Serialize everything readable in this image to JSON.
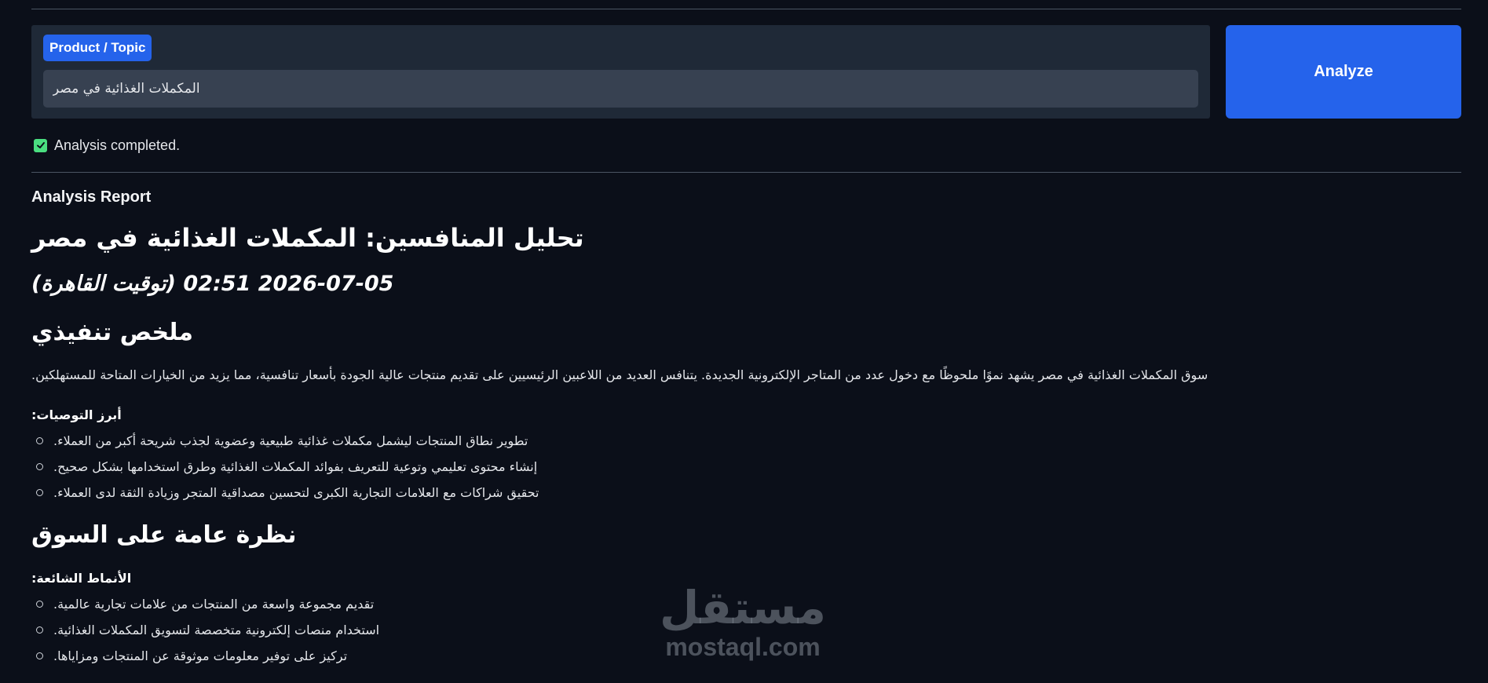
{
  "input": {
    "badge_label": "Product / Topic",
    "value": "المكملات الغذائية في مصر",
    "analyze_label": "Analyze"
  },
  "status": {
    "text": "Analysis completed.",
    "icon": "check-icon",
    "icon_color": "#4ade80"
  },
  "report": {
    "heading": "Analysis Report",
    "title": "تحليل المنافسين: المكملات الغذائية في مصر",
    "timestamp": "2026-07-05 02:51 (توقيت القاهرة)",
    "summary_heading": "ملخص تنفيذي",
    "summary_text": "سوق المكملات الغذائية في مصر يشهد نموًا ملحوظًا مع دخول عدد من المتاجر الإلكترونية الجديدة. يتنافس العديد من اللاعبين الرئيسيين على تقديم منتجات عالية الجودة بأسعار تنافسية، مما يزيد من الخيارات المتاحة للمستهلكين.",
    "recommendations_label": "أبرز التوصيات:",
    "recommendations": [
      "تطوير نطاق المنتجات ليشمل مكملات غذائية طبيعية وعضوية لجذب شريحة أكبر من العملاء.",
      "إنشاء محتوى تعليمي وتوعية للتعريف بفوائد المكملات الغذائية وطرق استخدامها بشكل صحيح.",
      "تحقيق شراكات مع العلامات التجارية الكبرى لتحسين مصداقية المتجر وزيادة الثقة لدى العملاء."
    ],
    "market_heading": "نظرة عامة على السوق",
    "patterns_label": "الأنماط الشائعة:",
    "patterns": [
      "تقديم مجموعة واسعة من المنتجات من علامات تجارية عالمية.",
      "استخدام منصات إلكترونية متخصصة لتسويق المكملات الغذائية.",
      "تركيز على توفير معلومات موثوقة عن المنتجات ومزاياها."
    ]
  },
  "watermark": {
    "logo": "مستقل",
    "url": "mostaql.com"
  },
  "colors": {
    "background": "#0b0f19",
    "panel": "#1f2937",
    "accent": "#2563eb",
    "success": "#4ade80"
  }
}
